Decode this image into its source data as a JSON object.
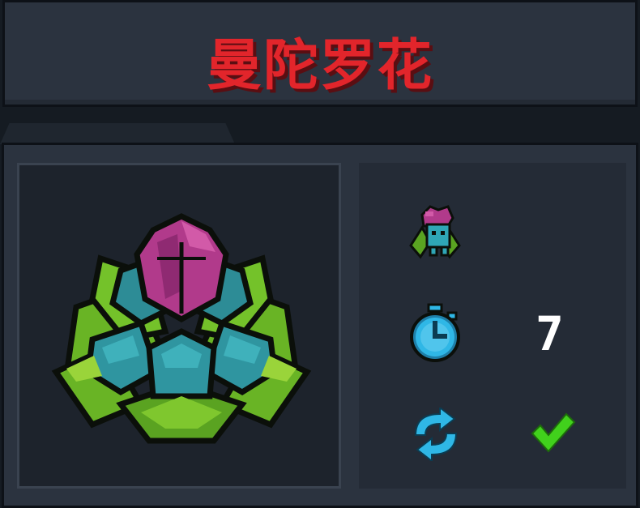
{
  "title": "曼陀罗花",
  "icons": {
    "preview": "mandrake-flower-icon",
    "type": "mandrake-creature-icon",
    "growth_time": "stopwatch-icon",
    "regrow": "refresh-arrows-icon",
    "regrow_status": "checkmark-icon"
  },
  "stats": {
    "growth_time_value": "7",
    "regrow_value": "✔"
  },
  "colors": {
    "title": "#e2252b",
    "panel_bg": "#2b333f",
    "accent_cyan": "#2fb7e6",
    "check_green": "#41d11c"
  }
}
